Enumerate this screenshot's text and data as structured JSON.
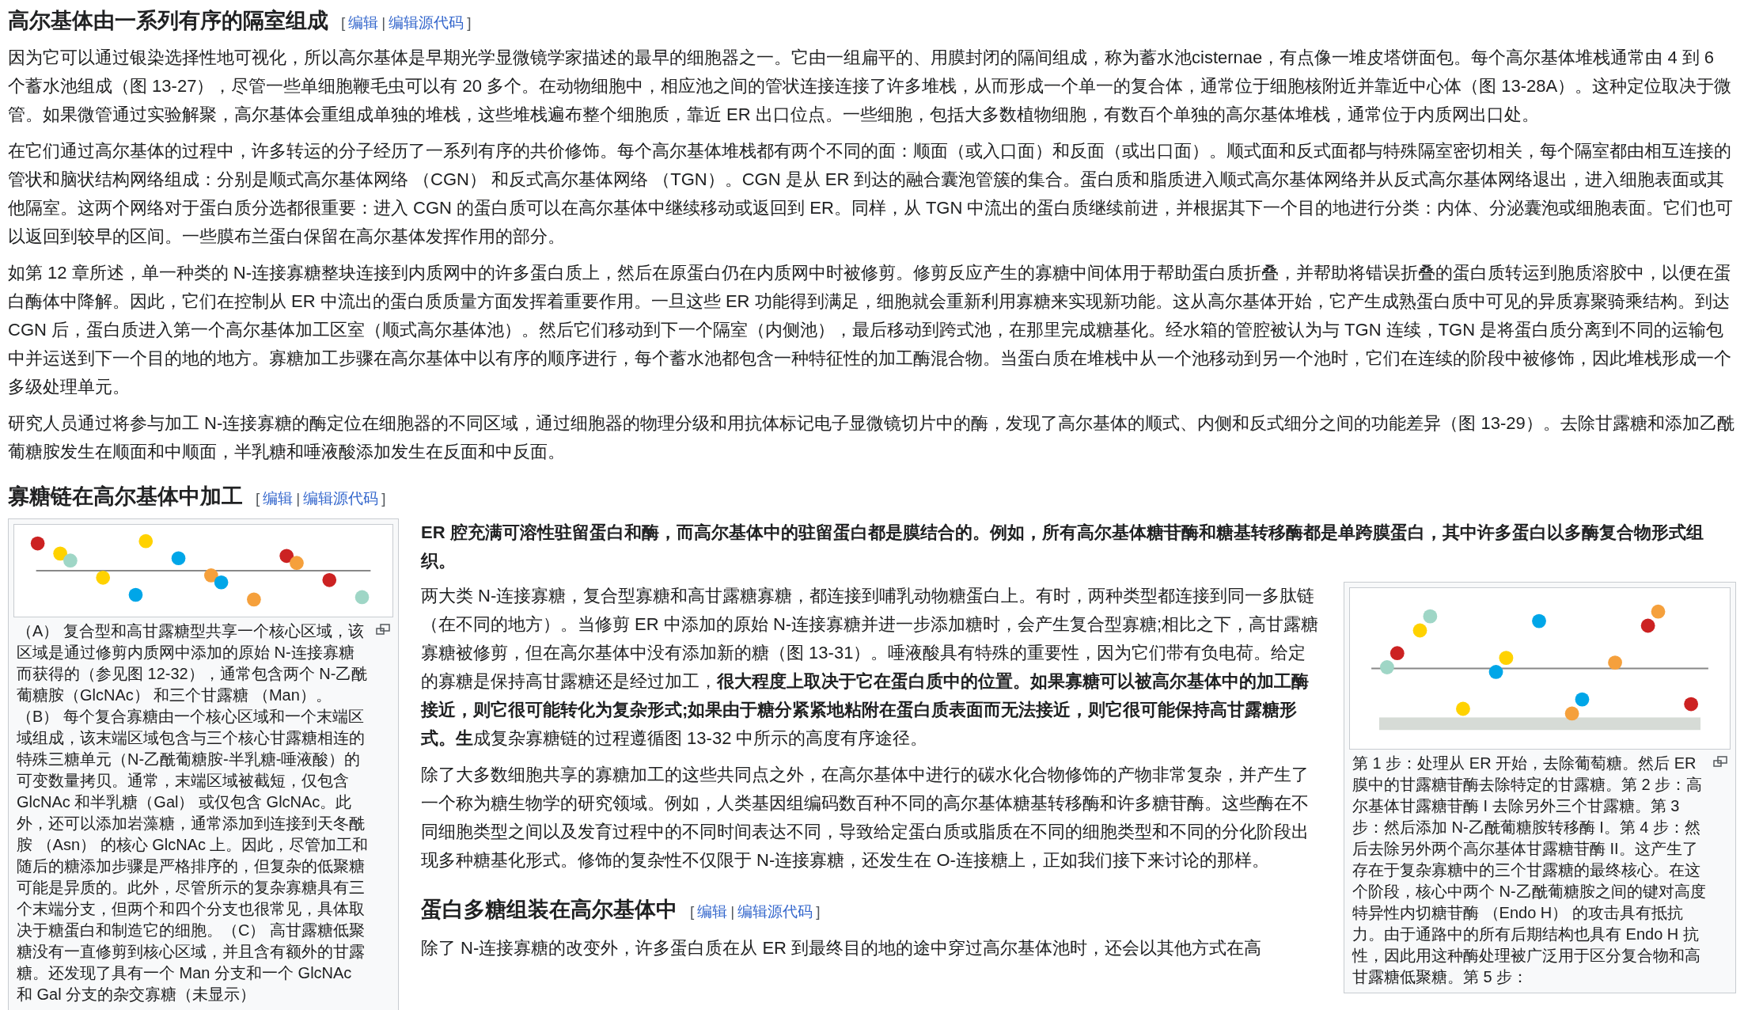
{
  "section_1": {
    "heading": {
      "title": "高尔基体由一系列有序的隔室组成",
      "bracket_open": "[",
      "edit": "编辑",
      "separator": "|",
      "edit_source": "编辑源代码",
      "bracket_close": "]"
    },
    "paragraphs": [
      "因为它可以通过银染选择性地可视化，所以高尔基体是早期光学显微镜学家描述的最早的细胞器之一。它由一组扁平的、用膜封闭的隔间组成，称为蓄水池cisternae，有点像一堆皮塔饼面包。每个高尔基体堆栈通常由 4 到 6 个蓄水池组成（图 13-27），尽管一些单细胞鞭毛虫可以有 20 多个。在动物细胞中，相应池之间的管状连接连接了许多堆栈，从而形成一个单一的复合体，通常位于细胞核附近并靠近中心体（图 13-28A）。这种定位取决于微管。如果微管通过实验解聚，高尔基体会重组成单独的堆栈，这些堆栈遍布整个细胞质，靠近 ER 出口位点。一些细胞，包括大多数植物细胞，有数百个单独的高尔基体堆栈，通常位于内质网出口处。",
      "在它们通过高尔基体的过程中，许多转运的分子经历了一系列有序的共价修饰。每个高尔基体堆栈都有两个不同的面：顺面（或入口面）和反面（或出口面）。顺式面和反式面都与特殊隔室密切相关，每个隔室都由相互连接的管状和脑状结构网络组成：分别是顺式高尔基体网络 （CGN） 和反式高尔基体网络 （TGN）。CGN 是从 ER 到达的融合囊泡管簇的集合。蛋白质和脂质进入顺式高尔基体网络并从反式高尔基体网络退出，进入细胞表面或其他隔室。这两个网络对于蛋白质分选都很重要：进入 CGN 的蛋白质可以在高尔基体中继续移动或返回到 ER。同样，从 TGN 中流出的蛋白质继续前进，并根据其下一个目的地进行分类：内体、分泌囊泡或细胞表面。它们也可以返回到较早的区间。一些膜布兰蛋白保留在高尔基体发挥作用的部分。",
      "如第 12 章所述，单一种类的 N-连接寡糖整块连接到内质网中的许多蛋白质上，然后在原蛋白仍在内质网中时被修剪。修剪反应产生的寡糖中间体用于帮助蛋白质折叠，并帮助将错误折叠的蛋白质转运到胞质溶胶中，以便在蛋白酶体中降解。因此，它们在控制从 ER 中流出的蛋白质质量方面发挥着重要作用。一旦这些 ER 功能得到满足，细胞就会重新利用寡糖来实现新功能。这从高尔基体开始，它产生成熟蛋白质中可见的异质寡聚骑乘结构。到达 CGN 后，蛋白质进入第一个高尔基体加工区室（顺式高尔基体池）。然后它们移动到下一个隔室（内侧池），最后移动到跨式池，在那里完成糖基化。经水箱的管腔被认为与 TGN 连续，TGN 是将蛋白质分离到不同的运输包中并运送到下一个目的地的地方。寡糖加工步骤在高尔基体中以有序的顺序进行，每个蓄水池都包含一种特征性的加工酶混合物。当蛋白质在堆栈中从一个池移动到另一个池时，它们在连续的阶段中被修饰，因此堆栈形成一个多级处理单元。",
      "研究人员通过将参与加工 N-连接寡糖的酶定位在细胞器的不同区域，通过细胞器的物理分级和用抗体标记电子显微镜切片中的酶，发现了高尔基体的顺式、内侧和反式细分之间的功能差异（图 13-29）。去除甘露糖和添加乙酰葡糖胺发生在顺面和中顺面，半乳糖和唾液酸添加发生在反面和中反面。"
    ]
  },
  "section_2": {
    "heading": {
      "title": "寡糖链在高尔基体中加工",
      "bracket_open": "[",
      "edit": "编辑",
      "separator": "|",
      "edit_source": "编辑源代码",
      "bracket_close": "]"
    },
    "left_figure": {
      "kind": "picture",
      "caption": "（A） 复合型和高甘露糖型共享一个核心区域，该区域是通过修剪内质网中添加的原始 N-连接寡糖而获得的（参见图 12-32），通常包含两个 N-乙酰葡糖胺（GlcNAc） 和三个甘露糖 （Man）。（B） 每个复合寡糖由一个核心区域和一个末端区域组成，该末端区域包含与三个核心甘露糖相连的特殊三糖单元（N-乙酰葡糖胺-半乳糖-唾液酸）的可变数量拷贝。通常，末端区域被截短，仅包含 GlcNAc 和半乳糖（Gal） 或仅包含 GlcNAc。此外，还可以添加岩藻糖，通常添加到连接到天冬酰胺 （Asn） 的核心 GlcNAc 上。因此，尽管加工和随后的糖添加步骤是严格排序的，但复杂的低聚糖可能是异质的。此外，尽管所示的复杂寡糖具有三个末端分支，但两个和四个分支也很常见，具体取决于糖蛋白和制造它的细胞。（C） 高甘露糖低聚糖没有一直修剪到核心区域，并且含有额外的甘露糖。还发现了具有一个 Man 分支和一个 GlcNAc 和 Gal 分支的杂交寡糖（未显示）"
    },
    "lead": "E**R 腔充满可溶性驻留蛋白和酶，而高尔基体中的驻留蛋白都是膜结合的。例如，所有高尔基体糖苷酶和糖基转移酶都是单跨膜蛋白，其中许多蛋白以多酶复合物形式组织。**",
    "paragraphs": [
      "两大类 N-连接寡糖，复合型寡糖和高甘露糖寡糖，都连接到哺乳动物糖蛋白上。有时，两种类型都连接到同一多肽链（在不同的地方）。当修剪 ER 中添加的原始 N-连接寡糖并进一步添加糖时，会产生复合型寡糖;相比之下，高甘露糖寡糖被修剪，但在高尔基体中没有添加新的糖（图 13-31）。唾液酸具有特殊的重要性，因为它们带有负电荷。给定的寡糖是保持高甘露糖还是经过加工，**很大程度上取决于它在蛋白质中的位置。如果寡糖可以被高尔基体中的加工酶接近，则它很可能转化为复杂形式;如果由于糖分紧紧地粘附在蛋白质表面而无法接近，则它很可能保持高甘露糖形式。生**成复杂寡糖链的过程遵循图 13-32 中所示的高度有序途径。",
      "除了大多数细胞共享的寡糖加工的这些共同点之外，在高尔基体中进行的碳水化合物修饰的产物非常复杂，并产生了一个称为糖生物学的研究领域。例如，人类基因组编码数百种不同的高尔基体糖基转移酶和许多糖苷酶。这些酶在不同细胞类型之间以及发育过程中的不同时间表达不同，导致给定蛋白质或脂质在不同的细胞类型和不同的分化阶段出现多种糖基化形式。修饰的复杂性不仅限于 N-连接寡糖，还发生在 O-连接糖上，正如我们接下来讨论的那样。"
    ],
    "right_figure": {
      "kind": "picture",
      "caption": "第 1 步：处理从 ER 开始，去除葡萄糖。然后 ER 膜中的甘露糖苷酶去除特定的甘露糖。第 2 步：高尔基体甘露糖苷酶 I 去除另外三个甘露糖。第 3 步：然后添加 N-乙酰葡糖胺转移酶 I。第 4 步：然后去除另外两个高尔基体甘露糖苷酶 II。这产生了存在于复杂寡糖中的三个甘露糖的最终核心。在这个阶段，核心中两个 N-乙酰葡糖胺之间的键对高度特异性内切糖苷酶 （Endo H） 的攻击具有抵抗力。由于通路中的所有后期结构也具有 Endo H 抗性，因此用这种酶处理被广泛用于区分复合物和高甘露糖低聚糖。第 5 步："
    }
  },
  "section_3": {
    "heading": {
      "title": "蛋白多糖组装在高尔基体中",
      "bracket_open": "[",
      "edit": "编辑",
      "separator": "|",
      "edit_source": "编辑源代码",
      "bracket_close": "]"
    },
    "paragraphs": [
      "除了 N-连接寡糖的改变外，许多蛋白质在从 ER 到最终目的地的途中穿过高尔基体池时，还会以其他方式在高"
    ]
  }
}
